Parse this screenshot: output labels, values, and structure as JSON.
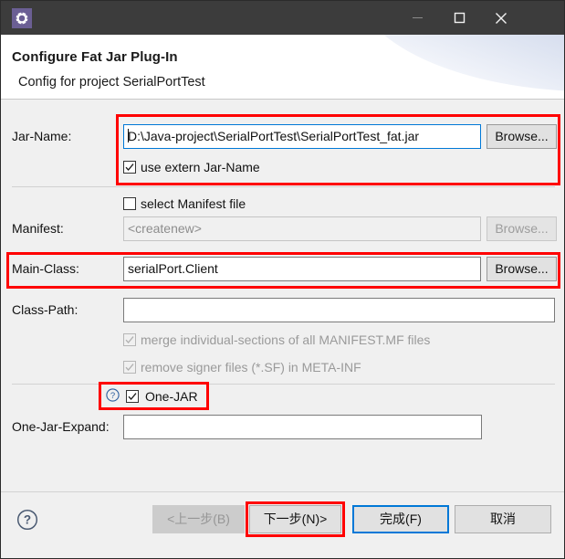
{
  "window": {
    "icon_name": "fat-jar-gear-icon",
    "controls": {
      "minimize": "minimize-icon",
      "maximize": "maximize-icon",
      "close": "close-icon"
    }
  },
  "header": {
    "title": "Configure Fat Jar Plug-In",
    "subtitle": "Config for project SerialPortTest"
  },
  "form": {
    "jar_name": {
      "label": "Jar-Name:",
      "value": "D:\\Java-project\\SerialPortTest\\SerialPortTest_fat.jar",
      "browse_label": "Browse...",
      "focused": true
    },
    "use_extern_jar_name": {
      "label": "use extern Jar-Name",
      "checked": true,
      "enabled": true
    },
    "select_manifest_file": {
      "label": "select Manifest file",
      "checked": false,
      "enabled": true
    },
    "manifest": {
      "label": "Manifest:",
      "value": "<createnew>",
      "browse_label": "Browse...",
      "enabled": false
    },
    "main_class": {
      "label": "Main-Class:",
      "value": "serialPort.Client",
      "browse_label": "Browse...",
      "enabled": true
    },
    "class_path": {
      "label": "Class-Path:",
      "value": "",
      "enabled": true
    },
    "merge_individual_sections": {
      "label": "merge individual-sections of all MANIFEST.MF files",
      "checked": true,
      "enabled": false
    },
    "remove_signer_files": {
      "label": "remove signer files (*.SF) in META-INF",
      "checked": true,
      "enabled": false
    },
    "one_jar": {
      "label": "One-JAR",
      "checked": true,
      "enabled": true,
      "help_icon": "help-circle-icon"
    },
    "one_jar_expand": {
      "label": "One-Jar-Expand:",
      "value": "",
      "enabled": true
    }
  },
  "footer": {
    "help_icon": "help-circle-icon",
    "back_label": "<上一步(B)",
    "next_label": "下一步(N)>",
    "finish_label": "完成(F)",
    "cancel_label": "取消"
  },
  "colors": {
    "annotation": "#ff0000",
    "focus": "#0078d7",
    "titlebar": "#3c3c3c",
    "dialog_bg": "#f0f0f0"
  }
}
